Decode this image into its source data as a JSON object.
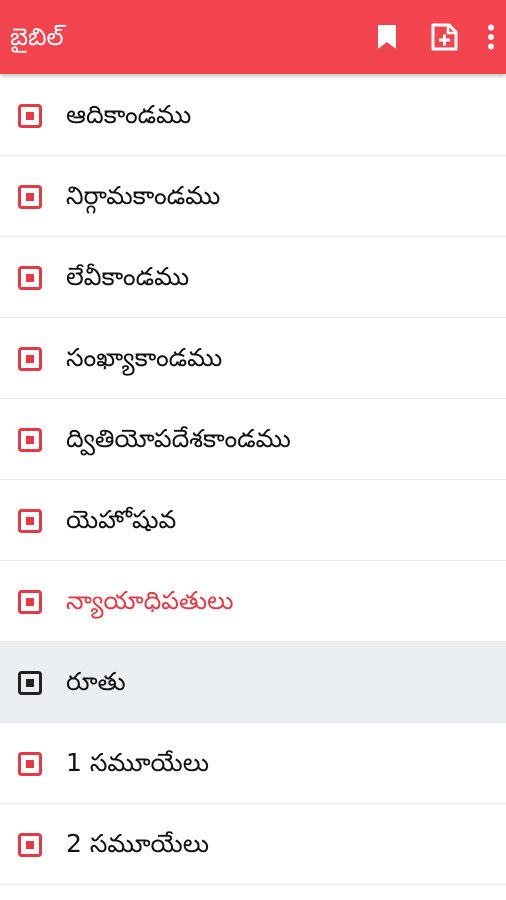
{
  "appbar": {
    "title": "బైబిల్",
    "background_color": "#f2444f",
    "actions": [
      {
        "icon": "bookmark-icon"
      },
      {
        "icon": "add-note-icon"
      },
      {
        "icon": "more-vert-icon"
      }
    ]
  },
  "colors": {
    "accent": "#e63946",
    "selected_icon": "#222222",
    "selected_row_bg": "#eceff1"
  },
  "books": [
    {
      "label": "ఆదికాండము",
      "state": "normal"
    },
    {
      "label": "నిర్గామకాండము",
      "state": "normal"
    },
    {
      "label": "లేవీకాండము",
      "state": "normal"
    },
    {
      "label": "సంఖ్యాకాండము",
      "state": "normal"
    },
    {
      "label": "ద్వితియోపదేశకాండము",
      "state": "normal"
    },
    {
      "label": "యెహోషువ",
      "state": "normal"
    },
    {
      "label": "న్యాయాధిపతులు",
      "state": "highlighted"
    },
    {
      "label": "రూతు",
      "state": "selected"
    },
    {
      "label": "1 సమూయేలు",
      "state": "normal"
    },
    {
      "label": "2 సమూయేలు",
      "state": "normal"
    }
  ]
}
